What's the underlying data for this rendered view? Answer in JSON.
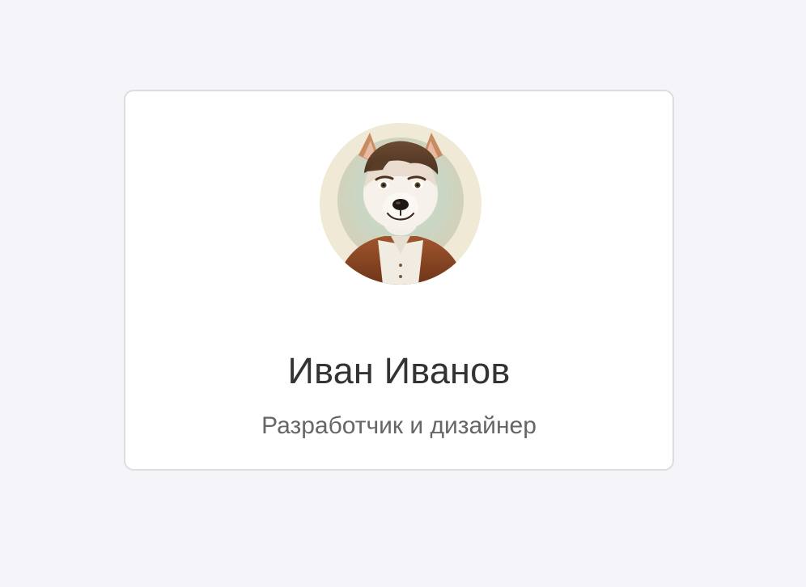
{
  "profile": {
    "name": "Иван Иванов",
    "role": "Разработчик и дизайнер",
    "avatar_icon": "fox-character-avatar"
  },
  "colors": {
    "page_background": "#f4f4f9",
    "card_background": "#ffffff",
    "card_border": "#dcdce2",
    "name_text": "#333333",
    "role_text": "#666666"
  }
}
